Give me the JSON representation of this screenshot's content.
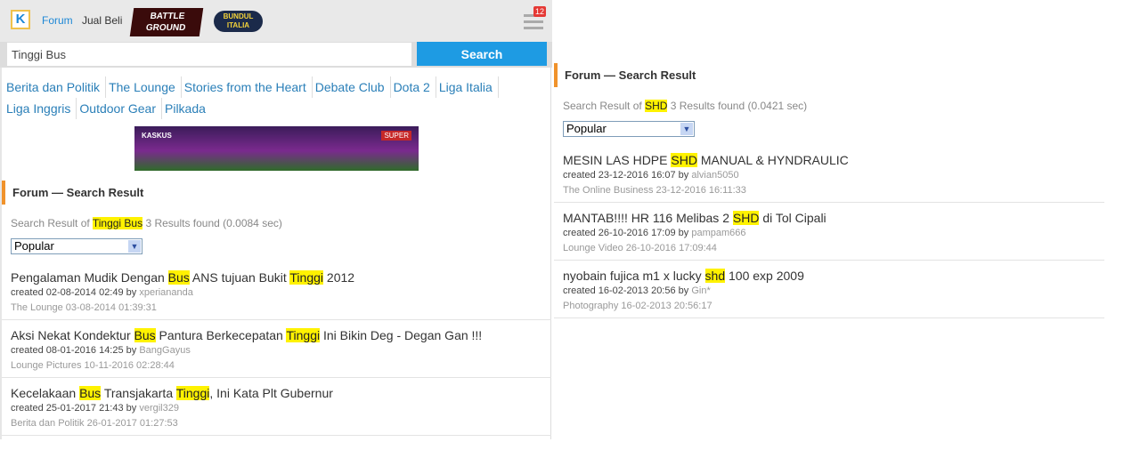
{
  "header": {
    "logo": "K",
    "nav_forum": "Forum",
    "nav_jual_beli": "Jual Beli",
    "logo_battleground": "BATTLE GROUND",
    "logo_bundul_italia": "BUNDUL ITALIA",
    "notification_count": "12"
  },
  "search": {
    "value": "Tinggi Bus",
    "button": "Search"
  },
  "tabs": [
    "Berita dan Politik",
    "The Lounge",
    "Stories from the Heart",
    "Debate Club",
    "Dota 2",
    "Liga Italia",
    "Liga Inggris",
    "Outdoor Gear",
    "Pilkada"
  ],
  "banner": {
    "brand": "KASKUS",
    "tag": "SUPER"
  },
  "left_results": {
    "title": "Forum — Search Result",
    "prefix": "Search Result of",
    "query": "Tinggi Bus",
    "summary": "3 Results found (0.0084 sec)",
    "sort": "Popular",
    "items": [
      {
        "title": [
          {
            "t": "Pengalaman Mudik Dengan "
          },
          {
            "t": "Bus",
            "hl": true
          },
          {
            "t": " ANS tujuan Bukit "
          },
          {
            "t": "Tinggi",
            "hl": true
          },
          {
            "t": " 2012"
          }
        ],
        "created": "created 02-08-2014 02:49 by",
        "user": "xperiananda",
        "forum": "The Lounge 03-08-2014 01:39:31"
      },
      {
        "title": [
          {
            "t": "Aksi Nekat Kondektur "
          },
          {
            "t": "Bus",
            "hl": true
          },
          {
            "t": " Pantura Berkecepatan "
          },
          {
            "t": "Tinggi",
            "hl": true
          },
          {
            "t": " Ini Bikin Deg - Degan Gan !!!"
          }
        ],
        "created": "created 08-01-2016 14:25 by",
        "user": "BangGayus",
        "forum": "Lounge Pictures 10-11-2016 02:28:44"
      },
      {
        "title": [
          {
            "t": "Kecelakaan "
          },
          {
            "t": "Bus",
            "hl": true
          },
          {
            "t": " Transjakarta "
          },
          {
            "t": "Tinggi",
            "hl": true
          },
          {
            "t": ", Ini Kata Plt Gubernur"
          }
        ],
        "created": "created 25-01-2017 21:43 by",
        "user": "vergil329",
        "forum": "Berita dan Politik 26-01-2017 01:27:53"
      }
    ]
  },
  "right_results": {
    "title": "Forum — Search Result",
    "prefix": "Search Result of",
    "query": "SHD",
    "summary": "3 Results found (0.0421 sec)",
    "sort": "Popular",
    "items": [
      {
        "title": [
          {
            "t": "MESIN LAS HDPE "
          },
          {
            "t": "SHD",
            "hl": true
          },
          {
            "t": " MANUAL & HYNDRAULIC"
          }
        ],
        "created": "created 23-12-2016 16:07 by",
        "user": "alvian5050",
        "forum": "The Online Business 23-12-2016 16:11:33"
      },
      {
        "title": [
          {
            "t": "MANTAB!!!! HR 116 Melibas 2 "
          },
          {
            "t": "SHD",
            "hl": true
          },
          {
            "t": " di Tol Cipali"
          }
        ],
        "created": "created 26-10-2016 17:09 by",
        "user": "pampam666",
        "forum": "Lounge Video 26-10-2016 17:09:44"
      },
      {
        "title": [
          {
            "t": "nyobain fujica m1 x lucky "
          },
          {
            "t": "shd",
            "hl": true
          },
          {
            "t": " 100 exp 2009"
          }
        ],
        "created": "created 16-02-2013 20:56 by",
        "user": "Gin*",
        "forum": "Photography 16-02-2013 20:56:17"
      }
    ]
  }
}
